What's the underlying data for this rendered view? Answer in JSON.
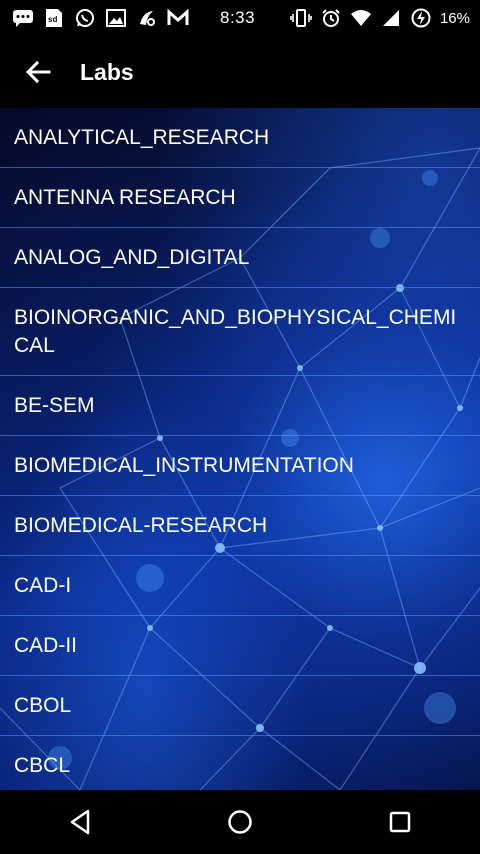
{
  "status_bar": {
    "time": "8:33",
    "battery": "16%",
    "left_icons": [
      "chat-icon",
      "sd-card-icon",
      "whatsapp-icon",
      "image-icon",
      "app-icon",
      "gmail-icon"
    ],
    "right_icons": [
      "vibrate-icon",
      "alarm-icon",
      "wifi-icon",
      "signal-icon",
      "battery-icon"
    ]
  },
  "app_bar": {
    "title": "Labs",
    "back_icon": "arrow-back-icon"
  },
  "labs": [
    {
      "label": "ANALYTICAL_RESEARCH"
    },
    {
      "label": "ANTENNA RESEARCH"
    },
    {
      "label": "ANALOG_AND_DIGITAL"
    },
    {
      "label": "BIOINORGANIC_AND_BIOPHYSICAL_CHEMICAL"
    },
    {
      "label": "BE-SEM"
    },
    {
      "label": "BIOMEDICAL_INSTRUMENTATION"
    },
    {
      "label": "BIOMEDICAL-RESEARCH"
    },
    {
      "label": "CAD-I"
    },
    {
      "label": "CAD-II"
    },
    {
      "label": "CBOL"
    },
    {
      "label": "CBCL"
    }
  ],
  "nav_bar": {
    "buttons": [
      "back-triangle-icon",
      "home-circle-icon",
      "recents-square-icon"
    ]
  },
  "colors": {
    "divider": "#5a96ff",
    "text": "#ffffff",
    "bar_background": "#000000"
  }
}
